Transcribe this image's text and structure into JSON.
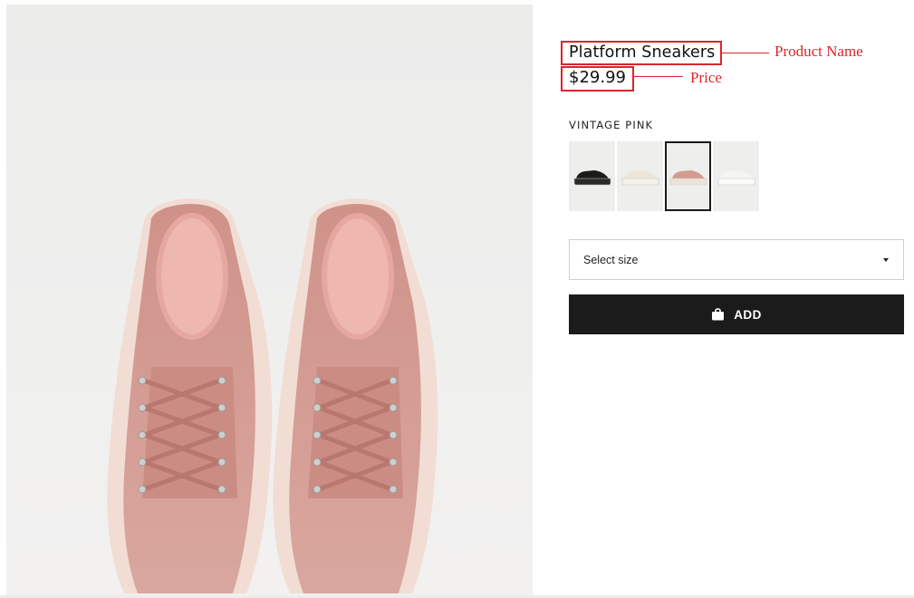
{
  "product": {
    "name": "Platform Sneakers",
    "price": "$29.99",
    "color_label": "VINTAGE PINK",
    "color_hex": "#d49c94"
  },
  "swatches": [
    {
      "name": "black",
      "color": "#1b1b1b",
      "sole": "#2a2a2a",
      "selected": false
    },
    {
      "name": "cream",
      "color": "#ebe6d6",
      "sole": "#f4f1e6",
      "selected": false
    },
    {
      "name": "vintage-pink",
      "color": "#d39c92",
      "sole": "#eee3d8",
      "selected": true
    },
    {
      "name": "white",
      "color": "#f5f5f5",
      "sole": "#fbfbfb",
      "selected": false
    }
  ],
  "size_select": {
    "label": "Select size",
    "icon": "caret-down-icon"
  },
  "add_button": {
    "label": "ADD",
    "icon": "shopping-bag-icon"
  },
  "annotations": {
    "product_name_label": "Product Name",
    "price_label": "Price",
    "color": "#d9262c"
  }
}
